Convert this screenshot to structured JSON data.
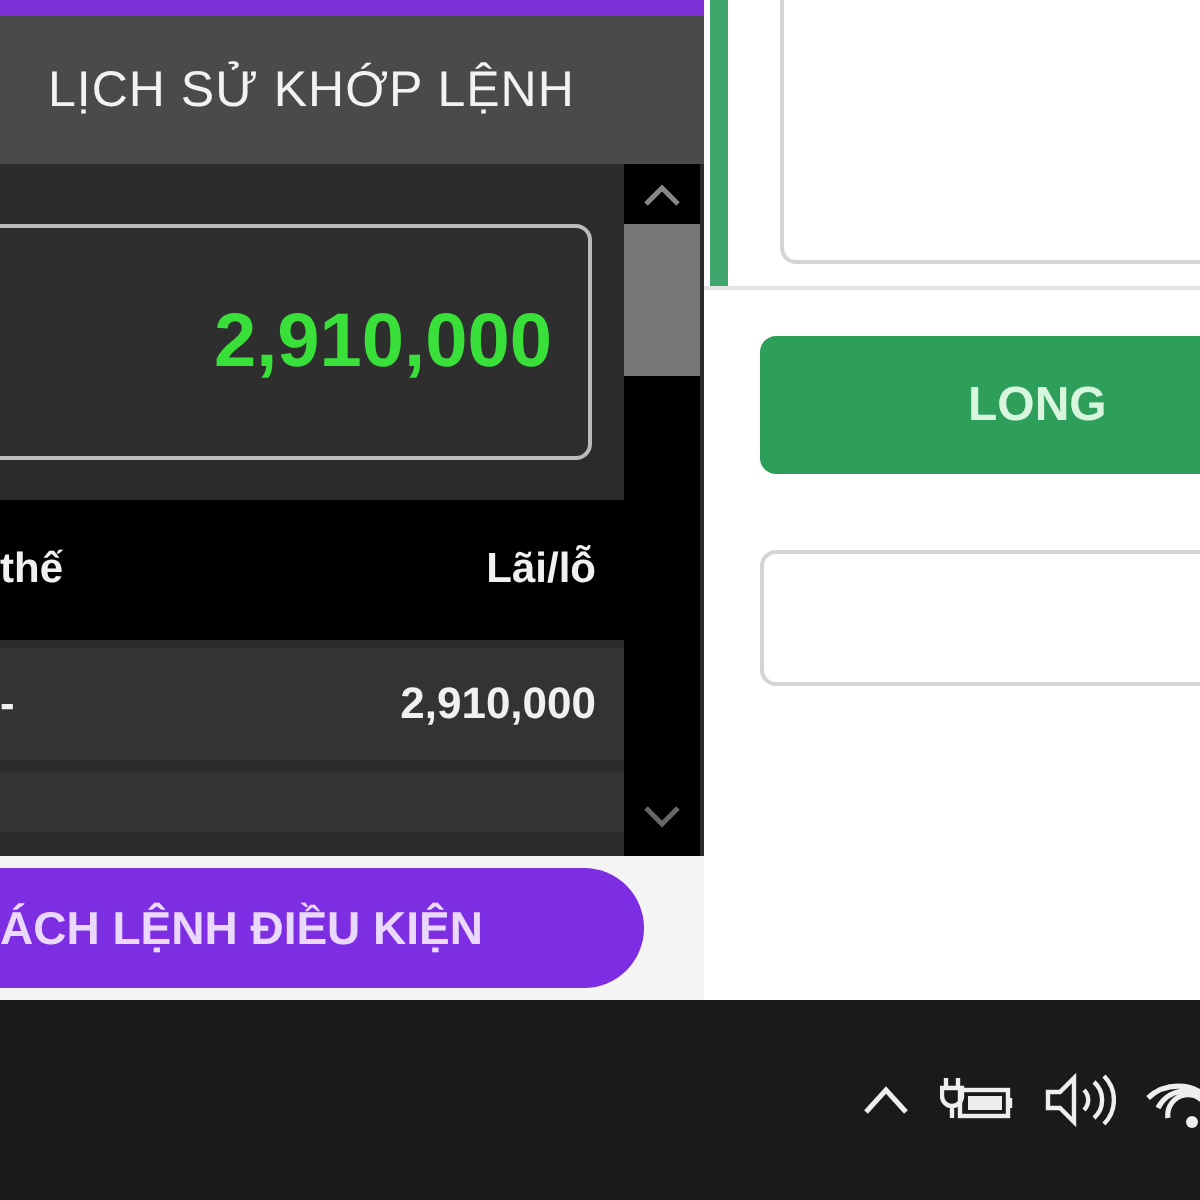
{
  "left_panel": {
    "title": "LỊCH SỬ KHỚP LỆNH",
    "summary_value": "2,910,000",
    "table": {
      "columns": [
        "thế",
        "Lãi/lỗ"
      ],
      "rows": [
        [
          "-",
          "2,910,000"
        ]
      ]
    },
    "button": "ÁCH LỆNH ĐIỀU KIỆN"
  },
  "right_panel": {
    "button": "LONG"
  }
}
